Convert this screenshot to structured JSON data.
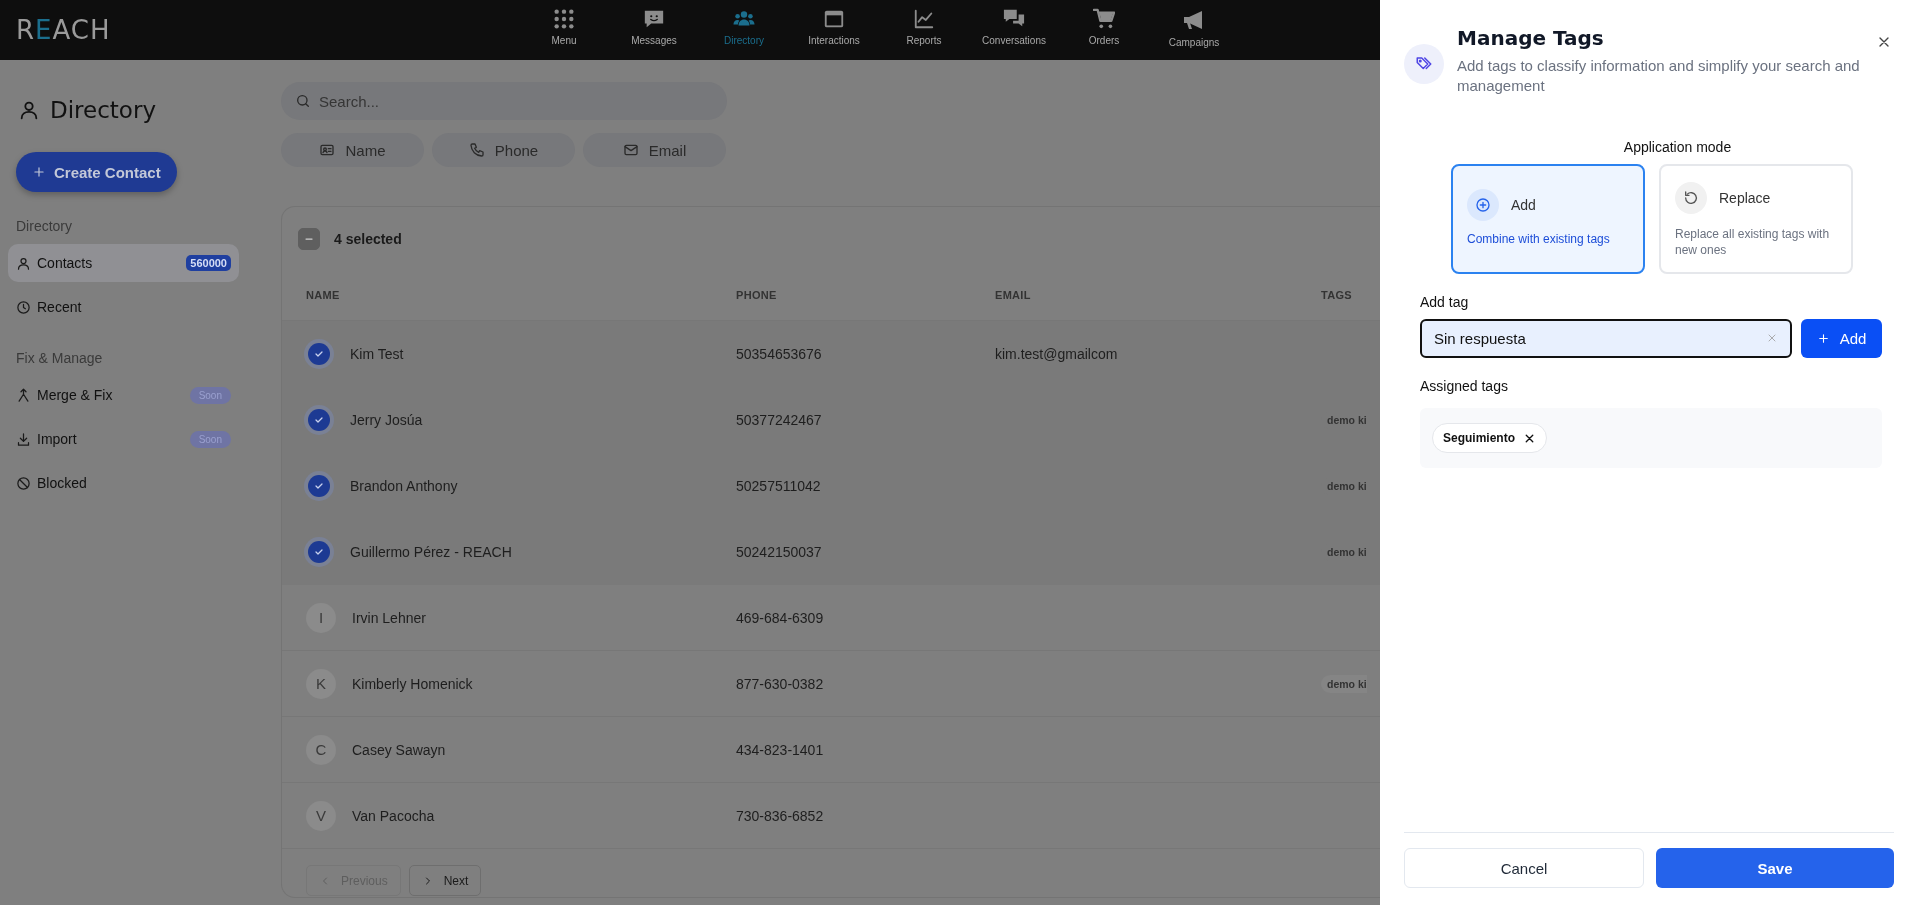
{
  "top_nav": {
    "logo": "REACH",
    "items": [
      {
        "label": "Menu",
        "selected": false
      },
      {
        "label": "Messages",
        "selected": false
      },
      {
        "label": "Directory",
        "selected": true
      },
      {
        "label": "Interactions",
        "selected": false
      },
      {
        "label": "Reports",
        "selected": false
      },
      {
        "label": "Conversations",
        "selected": false
      },
      {
        "label": "Orders",
        "selected": false
      },
      {
        "label": "Campaigns",
        "selected": false
      }
    ]
  },
  "sidebar": {
    "title": "Directory",
    "create_button": "Create Contact",
    "sections": [
      {
        "heading": "Directory",
        "items": [
          {
            "label": "Contacts",
            "badge": "560000",
            "selected": true
          },
          {
            "label": "Recent",
            "selected": false
          }
        ]
      },
      {
        "heading": "Fix & Manage",
        "items": [
          {
            "label": "Merge & Fix",
            "badge": "Soon",
            "selected": false
          },
          {
            "label": "Import",
            "badge": "Soon",
            "selected": false
          },
          {
            "label": "Blocked",
            "selected": false
          }
        ]
      }
    ]
  },
  "search": {
    "placeholder": "Search..."
  },
  "filters": [
    "Name",
    "Phone",
    "Email"
  ],
  "table": {
    "select_all_indeterminate": true,
    "selection_label": "4 selected",
    "columns": [
      "NAME",
      "PHONE",
      "EMAIL",
      "TAGS"
    ],
    "rows": [
      {
        "selected": true,
        "name": "Kim Test",
        "phone": "50354653676",
        "email": "kim.test@gmailcom"
      },
      {
        "selected": true,
        "name": "Jerry Josúa",
        "phone": "50377242467",
        "tags": [
          "demo ki"
        ]
      },
      {
        "selected": true,
        "name": "Brandon Anthony",
        "phone": "50257511042",
        "tags": [
          "demo ki"
        ]
      },
      {
        "selected": true,
        "name": "Guillermo Pérez - REACH",
        "phone": "50242150037",
        "tags": [
          "demo ki"
        ]
      },
      {
        "selected": false,
        "initial": "I",
        "name": "Irvin Lehner",
        "phone": "469-684-6309"
      },
      {
        "selected": false,
        "initial": "K",
        "name": "Kimberly Homenick",
        "phone": "877-630-0382",
        "tags": [
          "demo ki"
        ]
      },
      {
        "selected": false,
        "initial": "C",
        "name": "Casey Sawayn",
        "phone": "434-823-1401"
      },
      {
        "selected": false,
        "initial": "V",
        "name": "Van Pacocha",
        "phone": "730-836-6852"
      }
    ]
  },
  "pagination": {
    "previous": {
      "label": "Previous",
      "disabled": true
    },
    "next": {
      "label": "Next",
      "disabled": false
    }
  },
  "manage_tags": {
    "title": "Manage Tags",
    "subtitle": "Add tags to classify information and simplify your search and management",
    "mode_heading": "Application mode",
    "modes": [
      {
        "label": "Add",
        "description": "Combine with existing tags",
        "selected": true
      },
      {
        "label": "Replace",
        "description": "Replace all existing tags with new ones",
        "selected": false
      }
    ],
    "add_tag_label": "Add tag",
    "input_value": "Sin respuesta",
    "add_button": "Add",
    "assigned_label": "Assigned tags",
    "assigned_tags": [
      "Seguimiento"
    ],
    "cancel_button": "Cancel",
    "save_button": "Save"
  }
}
